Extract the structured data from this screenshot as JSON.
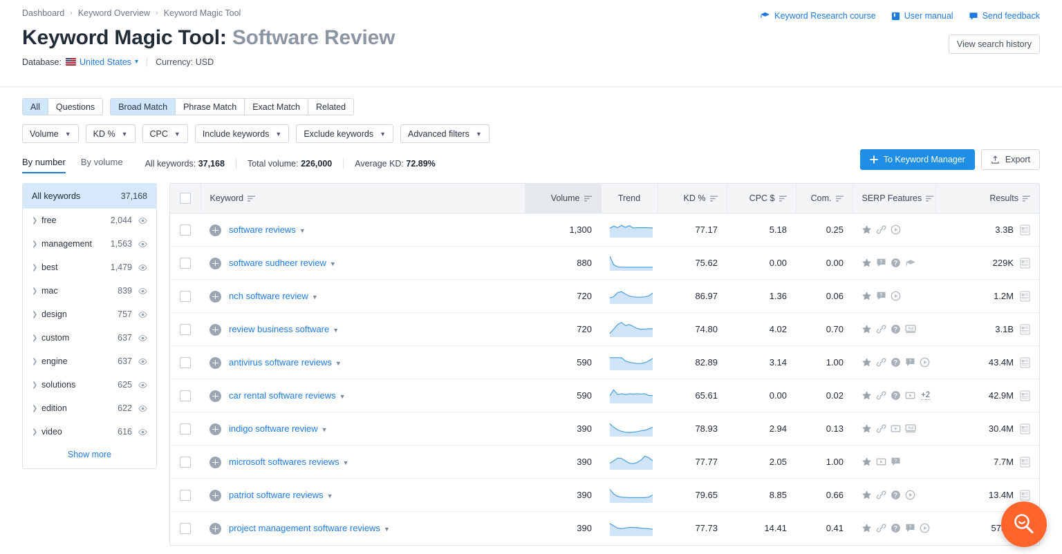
{
  "breadcrumb": [
    "Dashboard",
    "Keyword Overview",
    "Keyword Magic Tool"
  ],
  "header": {
    "title_main": "Keyword Magic Tool:",
    "title_sub": "Software Review",
    "database_label": "Database:",
    "database_value": "United States",
    "currency": "Currency: USD",
    "history_button": "View search history",
    "links": [
      {
        "label": "Keyword Research course",
        "icon": "graduation-cap-icon"
      },
      {
        "label": "User manual",
        "icon": "book-icon"
      },
      {
        "label": "Send feedback",
        "icon": "speech-bubble-icon"
      }
    ]
  },
  "match_tabs": [
    {
      "label": "All",
      "active": true
    },
    {
      "label": "Questions",
      "active": false
    },
    {
      "label": "Broad Match",
      "active": true
    },
    {
      "label": "Phrase Match",
      "active": false
    },
    {
      "label": "Exact Match",
      "active": false
    },
    {
      "label": "Related",
      "active": false
    }
  ],
  "filters": [
    "Volume",
    "KD %",
    "CPC",
    "Include keywords",
    "Exclude keywords",
    "Advanced filters"
  ],
  "view_tabs": [
    {
      "label": "By number",
      "active": true
    },
    {
      "label": "By volume",
      "active": false
    }
  ],
  "stats": [
    {
      "label": "All keywords:",
      "value": "37,168"
    },
    {
      "label": "Total volume:",
      "value": "226,000"
    },
    {
      "label": "Average KD:",
      "value": "72.89%"
    }
  ],
  "actions": {
    "keyword_manager": "To Keyword Manager",
    "export": "Export"
  },
  "sidebar": {
    "head_label": "All keywords",
    "head_count": "37,168",
    "items": [
      {
        "label": "free",
        "count": "2,044"
      },
      {
        "label": "management",
        "count": "1,563"
      },
      {
        "label": "best",
        "count": "1,479"
      },
      {
        "label": "mac",
        "count": "839"
      },
      {
        "label": "design",
        "count": "757"
      },
      {
        "label": "custom",
        "count": "637"
      },
      {
        "label": "engine",
        "count": "637"
      },
      {
        "label": "solutions",
        "count": "625"
      },
      {
        "label": "edition",
        "count": "622"
      },
      {
        "label": "video",
        "count": "616"
      }
    ],
    "show_more": "Show more"
  },
  "table": {
    "columns": [
      "Keyword",
      "Volume",
      "Trend",
      "KD %",
      "CPC $",
      "Com.",
      "SERP Features",
      "Results"
    ],
    "rows": [
      {
        "keyword": "software reviews",
        "volume": "1,300",
        "kd": "77.17",
        "cpc": "5.18",
        "com": "0.25",
        "serp": [
          "star-icon",
          "link-icon",
          "video-play-icon"
        ],
        "extra": "",
        "results": "3.3B",
        "trend": "0.55,0.72,0.60,0.78,0.62,0.76,0.58,0.60,0.60,0.60,0.60,0.58"
      },
      {
        "keyword": "software sudheer review",
        "volume": "880",
        "kd": "75.62",
        "cpc": "0.00",
        "com": "0.00",
        "serp": [
          "star-icon",
          "review-box-icon",
          "question-icon",
          "graduation-cap-icon"
        ],
        "extra": "",
        "results": "229K",
        "trend": "0.95,0.30,0.14,0.12,0.11,0.11,0.11,0.11,0.11,0.11,0.11,0.11"
      },
      {
        "keyword": "nch software review",
        "volume": "720",
        "kd": "86.97",
        "cpc": "1.36",
        "com": "0.06",
        "serp": [
          "star-icon",
          "review-box-icon",
          "video-play-icon"
        ],
        "extra": "",
        "results": "1.2M",
        "trend": "0.30,0.40,0.70,0.78,0.60,0.44,0.38,0.36,0.36,0.38,0.46,0.68"
      },
      {
        "keyword": "review business software",
        "volume": "720",
        "kd": "74.80",
        "cpc": "4.02",
        "com": "0.70",
        "serp": [
          "star-icon",
          "link-icon",
          "question-icon",
          "ad-icon"
        ],
        "extra": "",
        "results": "3.1B",
        "trend": "0.12,0.45,0.80,0.96,0.72,0.80,0.66,0.50,0.44,0.46,0.48,0.48"
      },
      {
        "keyword": "antivirus software reviews",
        "volume": "590",
        "kd": "82.89",
        "cpc": "3.14",
        "com": "1.00",
        "serp": [
          "star-icon",
          "link-icon",
          "question-icon",
          "review-box-icon",
          "video-play-icon"
        ],
        "extra": "",
        "results": "43.4M",
        "trend": "0.80,0.80,0.80,0.80,0.55,0.44,0.40,0.36,0.36,0.42,0.56,0.74"
      },
      {
        "keyword": "car rental software reviews",
        "volume": "590",
        "kd": "65.61",
        "cpc": "0.00",
        "com": "0.02",
        "serp": [
          "star-icon",
          "link-icon",
          "question-icon",
          "video-box-icon"
        ],
        "extra": "+2",
        "results": "42.9M",
        "trend": "0.42,0.88,0.52,0.58,0.52,0.58,0.55,0.58,0.55,0.58,0.45,0.45"
      },
      {
        "keyword": "indigo software review",
        "volume": "390",
        "kd": "78.93",
        "cpc": "2.94",
        "com": "0.13",
        "serp": [
          "star-icon",
          "link-icon",
          "video-box-icon",
          "ad-icon"
        ],
        "extra": "",
        "results": "30.4M",
        "trend": "0.82,0.56,0.36,0.24,0.18,0.16,0.18,0.22,0.28,0.32,0.42,0.56"
      },
      {
        "keyword": "microsoft softwares reviews",
        "volume": "390",
        "kd": "77.77",
        "cpc": "2.05",
        "com": "1.00",
        "serp": [
          "star-icon",
          "video-box-icon",
          "review-box-icon"
        ],
        "extra": "",
        "results": "7.7M",
        "trend": "0.34,0.52,0.72,0.70,0.52,0.34,0.30,0.40,0.58,0.88,0.76,0.52"
      },
      {
        "keyword": "patriot software reviews",
        "volume": "390",
        "kd": "79.65",
        "cpc": "8.85",
        "com": "0.66",
        "serp": [
          "star-icon",
          "link-icon",
          "question-icon",
          "video-play-icon"
        ],
        "extra": "",
        "results": "13.4M",
        "trend": "0.88,0.52,0.34,0.28,0.26,0.24,0.24,0.24,0.24,0.24,0.28,0.44"
      },
      {
        "keyword": "project management software reviews",
        "volume": "390",
        "kd": "77.73",
        "cpc": "14.41",
        "com": "0.41",
        "serp": [
          "star-icon",
          "link-icon",
          "question-icon",
          "review-box-icon",
          "video-play-icon"
        ],
        "extra": "",
        "results": "573M",
        "trend": "0.80,0.62,0.44,0.40,0.46,0.50,0.50,0.48,0.44,0.42,0.40,0.36"
      }
    ]
  },
  "fab": {
    "icon": "search-smile-icon"
  },
  "colors": {
    "accent_blue": "#1f7ae0",
    "button_blue": "#1f8fe5",
    "highlight": "#cfe6fb",
    "sidebar_head": "#d6e9fb",
    "fab_orange": "#ff642d",
    "spark_line": "#4a9fe0",
    "spark_fill": "#cfe4f7"
  }
}
